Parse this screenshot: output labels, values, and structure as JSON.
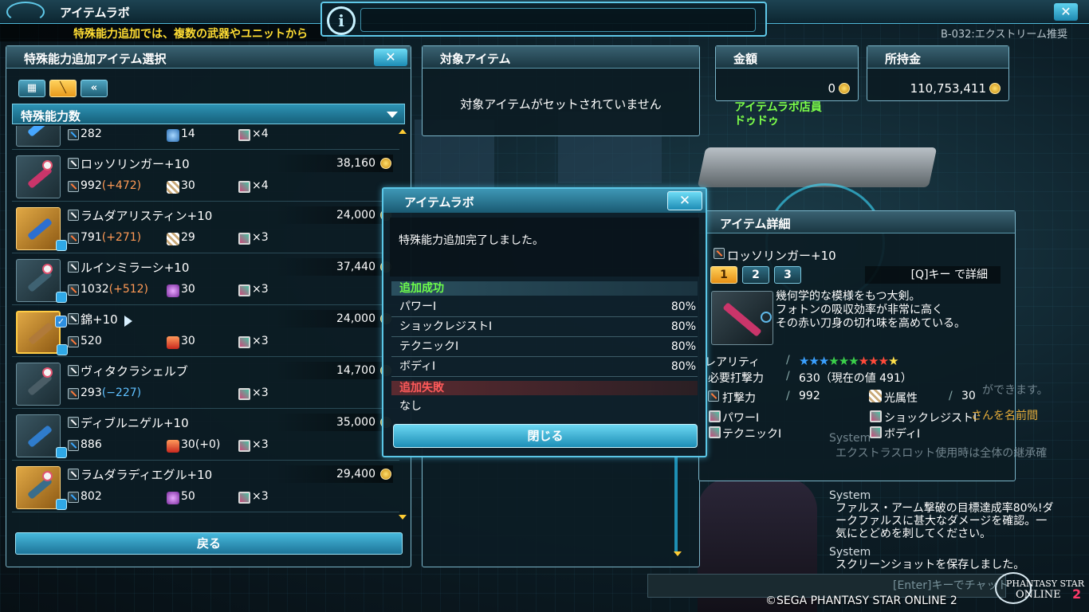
{
  "header": {
    "title": "アイテムラボ",
    "ticker": "特殊能力追加では、複数の武器やユニットから",
    "quest": "B-032:エクストリーム推奨"
  },
  "select_panel": {
    "title": "特殊能力追加アイテム選択",
    "close": "✕",
    "sort_label": "特殊能力数",
    "back_label": "戻る",
    "items": [
      {
        "name": "",
        "price": "",
        "atk": "282",
        "bonus": "",
        "bonus_dir": "",
        "elem": "14",
        "elem_type": "ice",
        "slots": "×4",
        "weapon_color": "blue",
        "thumb": "plain",
        "blade": "#46a7ff",
        "no": false,
        "lock": false,
        "check": false
      },
      {
        "name": "ロッソリンガー+10",
        "price": "38,160",
        "atk": "992",
        "bonus": "(+472)",
        "bonus_dir": "up",
        "elem": "30",
        "elem_type": "light",
        "slots": "×4",
        "weapon_color": "orange",
        "thumb": "plain",
        "blade": "#c9356a",
        "no": true,
        "lock": false,
        "check": false
      },
      {
        "name": "ラムダアリスティン+10",
        "price": "24,000",
        "atk": "791",
        "bonus": "(+271)",
        "bonus_dir": "up",
        "elem": "29",
        "elem_type": "light",
        "slots": "×3",
        "weapon_color": "orange",
        "thumb": "gold",
        "blade": "#2d6fd0",
        "no": false,
        "lock": true,
        "check": false
      },
      {
        "name": "ルインミラーシ+10",
        "price": "37,440",
        "atk": "1032",
        "bonus": "(+512)",
        "bonus_dir": "up",
        "elem": "30",
        "elem_type": "dark",
        "slots": "×3",
        "weapon_color": "orange",
        "thumb": "plain",
        "blade": "#3f6272",
        "no": true,
        "lock": true,
        "check": false
      },
      {
        "name": "錦+10",
        "price": "24,000",
        "atk": "520",
        "bonus": "",
        "bonus_dir": "",
        "elem": "30",
        "elem_type": "fire",
        "slots": "×3",
        "weapon_color": "orange",
        "thumb": "gold-sel",
        "blade": "#b07a3a",
        "no": false,
        "lock": true,
        "check": true
      },
      {
        "name": "ヴィタクラシェルブ",
        "price": "14,700",
        "atk": "293",
        "bonus": "(−227)",
        "bonus_dir": "down",
        "elem": "",
        "elem_type": "",
        "slots": "×3",
        "weapon_color": "orange",
        "thumb": "plain",
        "blade": "#4a5d66",
        "no": true,
        "lock": false,
        "check": false
      },
      {
        "name": "ディブルニゲル+10",
        "price": "35,000",
        "atk": "886",
        "bonus": "",
        "bonus_dir": "",
        "elem": "30(+0)",
        "elem_type": "fire",
        "slots": "×3",
        "weapon_color": "blue",
        "thumb": "plain",
        "blade": "#2f7ccc",
        "no": false,
        "lock": true,
        "check": false
      },
      {
        "name": "ラムダラディエグル+10",
        "price": "29,400",
        "atk": "802",
        "bonus": "",
        "bonus_dir": "",
        "elem": "50",
        "elem_type": "dark",
        "slots": "×3",
        "weapon_color": "blue",
        "thumb": "gold",
        "blade": "#3a6d8a",
        "no": true,
        "lock": true,
        "check": false
      }
    ]
  },
  "target_panel": {
    "title": "対象アイテム",
    "message": "対象アイテムがセットされていません"
  },
  "cost_panel": {
    "title": "金額",
    "value": "0"
  },
  "money_panel": {
    "title": "所持金",
    "value": "110,753,411"
  },
  "staff": {
    "line1": "アイテムラボ店員",
    "line2": "ドゥドゥ"
  },
  "detail_panel": {
    "title": "アイテム詳細",
    "name": "ロッソリンガー+10",
    "tabs": [
      "1",
      "2",
      "3"
    ],
    "hint": "[Q]キー で詳細",
    "desc": [
      "幾何学的な模様をもつ大剣。",
      "フォトンの吸収効率が非常に高く",
      "その赤い刀身の切れ味を高めている。"
    ],
    "rarity_label": "レアリティ",
    "stars": [
      "#3aa0ff",
      "#3aa0ff",
      "#3aa0ff",
      "#3ad04a",
      "#3ad04a",
      "#3ad04a",
      "#ff4a3a",
      "#ff4a3a",
      "#ff4a3a",
      "#ffe04a"
    ],
    "req_label": "必要打撃力",
    "req_value": "630（現在の値 491）",
    "atk_label": "打撃力",
    "atk_value": "992",
    "elem_label": "光属性",
    "elem_value": "30",
    "abilities": [
      "パワーI",
      "ショックレジストI",
      "テクニックI",
      "ボディI"
    ]
  },
  "modal": {
    "title": "アイテムラボ",
    "close": "✕",
    "message": "特殊能力追加完了しました。",
    "success_label": "追加成功",
    "success": [
      {
        "name": "パワーI",
        "pct": "80%"
      },
      {
        "name": "ショックレジストI",
        "pct": "80%"
      },
      {
        "name": "テクニックI",
        "pct": "80%"
      },
      {
        "name": "ボディI",
        "pct": "80%"
      }
    ],
    "fail_label": "追加失敗",
    "fail_value": "なし",
    "button": "閉じる"
  },
  "chat": {
    "bg_text": [
      "ができます。",
      "さんを名前間",
      "System",
      "エクストラスロット使用時は全体の継承確"
    ],
    "lines": [
      {
        "text": "System",
        "sys": true
      },
      {
        "text": "ファルス・アーム撃破の目標達成率80%!ダ",
        "sys": false
      },
      {
        "text": "ークファルスに甚大なダメージを確認。一",
        "sys": false
      },
      {
        "text": "気にとどめを刺してください。",
        "sys": false
      },
      {
        "text": "System",
        "sys": true
      },
      {
        "text": "スクリーンショットを保存しました。",
        "sys": false
      }
    ],
    "input_hint": "[Enter]キーでチャット"
  },
  "footer": {
    "copyright": "©SEGA PHANTASY STAR ONLINE 2",
    "logo_line1": "PHANTASY STAR",
    "logo_line2": "ONLINE",
    "logo_num": "2"
  }
}
